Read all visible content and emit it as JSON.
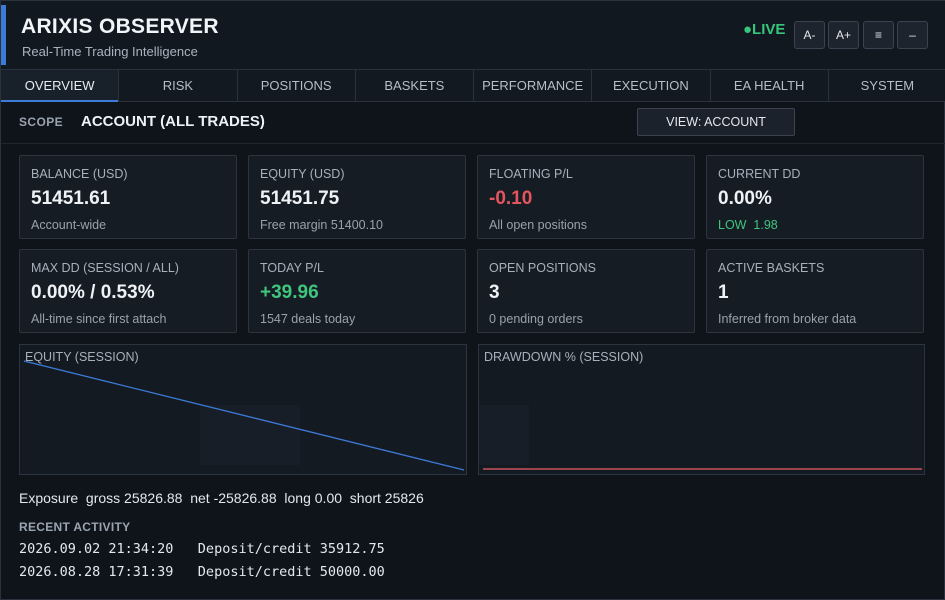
{
  "app": {
    "title": "ARIXIS OBSERVER",
    "subtitle": "Real-Time Trading Intelligence",
    "live_label": "●LIVE",
    "accent_color": "#3d7bd8",
    "live_color": "#36c57a",
    "buttons": [
      {
        "label": "A-",
        "name": "font-decrease-button"
      },
      {
        "label": "A+",
        "name": "font-increase-button"
      },
      {
        "label": "≡",
        "name": "menu-button"
      },
      {
        "label": "–",
        "name": "minimize-button"
      }
    ]
  },
  "tabs": [
    {
      "label": "OVERVIEW",
      "active": true
    },
    {
      "label": "RISK"
    },
    {
      "label": "POSITIONS"
    },
    {
      "label": "BASKETS"
    },
    {
      "label": "PERFORMANCE"
    },
    {
      "label": "EXECUTION"
    },
    {
      "label": "EA HEALTH"
    },
    {
      "label": "SYSTEM"
    }
  ],
  "scope": {
    "label": "SCOPE",
    "value": "ACCOUNT (ALL TRADES)",
    "view_button": "VIEW: ACCOUNT"
  },
  "cards": [
    {
      "label": "BALANCE (USD)",
      "value": "51451.61",
      "sub": "Account-wide",
      "tone": "normal"
    },
    {
      "label": "EQUITY (USD)",
      "value": "51451.75",
      "sub": "Free margin 51400.10",
      "tone": "normal"
    },
    {
      "label": "FLOATING P/L",
      "value": "-0.10",
      "sub": "All open positions",
      "tone": "neg"
    },
    {
      "label": "CURRENT DD",
      "value": "0.00%",
      "sub": "LOW  1.98",
      "tone": "normal",
      "sub_tone": "ok"
    },
    {
      "label": "MAX DD (SESSION / ALL)",
      "value": "0.00% / 0.53%",
      "sub": "All-time since first attach",
      "tone": "normal"
    },
    {
      "label": "TODAY P/L",
      "value": "+39.96",
      "sub": "1547 deals today",
      "tone": "pos"
    },
    {
      "label": "OPEN POSITIONS",
      "value": "3",
      "sub": "0 pending orders",
      "tone": "normal"
    },
    {
      "label": "ACTIVE BASKETS",
      "value": "1",
      "sub": "Inferred from broker data",
      "tone": "normal"
    }
  ],
  "charts": {
    "equity_title": "EQUITY (SESSION)",
    "drawdown_title": "DRAWDOWN % (SESSION)",
    "equity_color": "#3d7bd8",
    "drawdown_color": "#c9535c"
  },
  "chart_data": [
    {
      "type": "line",
      "title": "EQUITY (SESSION)",
      "series": [
        {
          "values": [
            1,
            0
          ]
        }
      ],
      "note_trend": "descending"
    },
    {
      "type": "line",
      "title": "DRAWDOWN % (SESSION)",
      "series": [
        {
          "values": [
            0,
            0
          ]
        }
      ]
    }
  ],
  "exposure_text": "Exposure  gross 25826.88  net -25826.88  long 0.00  short 25826",
  "recent": {
    "title": "RECENT ACTIVITY",
    "rows": [
      "2026.09.02 21:34:20   Deposit/credit 35912.75",
      "2026.08.28 17:31:39   Deposit/credit 50000.00"
    ]
  }
}
